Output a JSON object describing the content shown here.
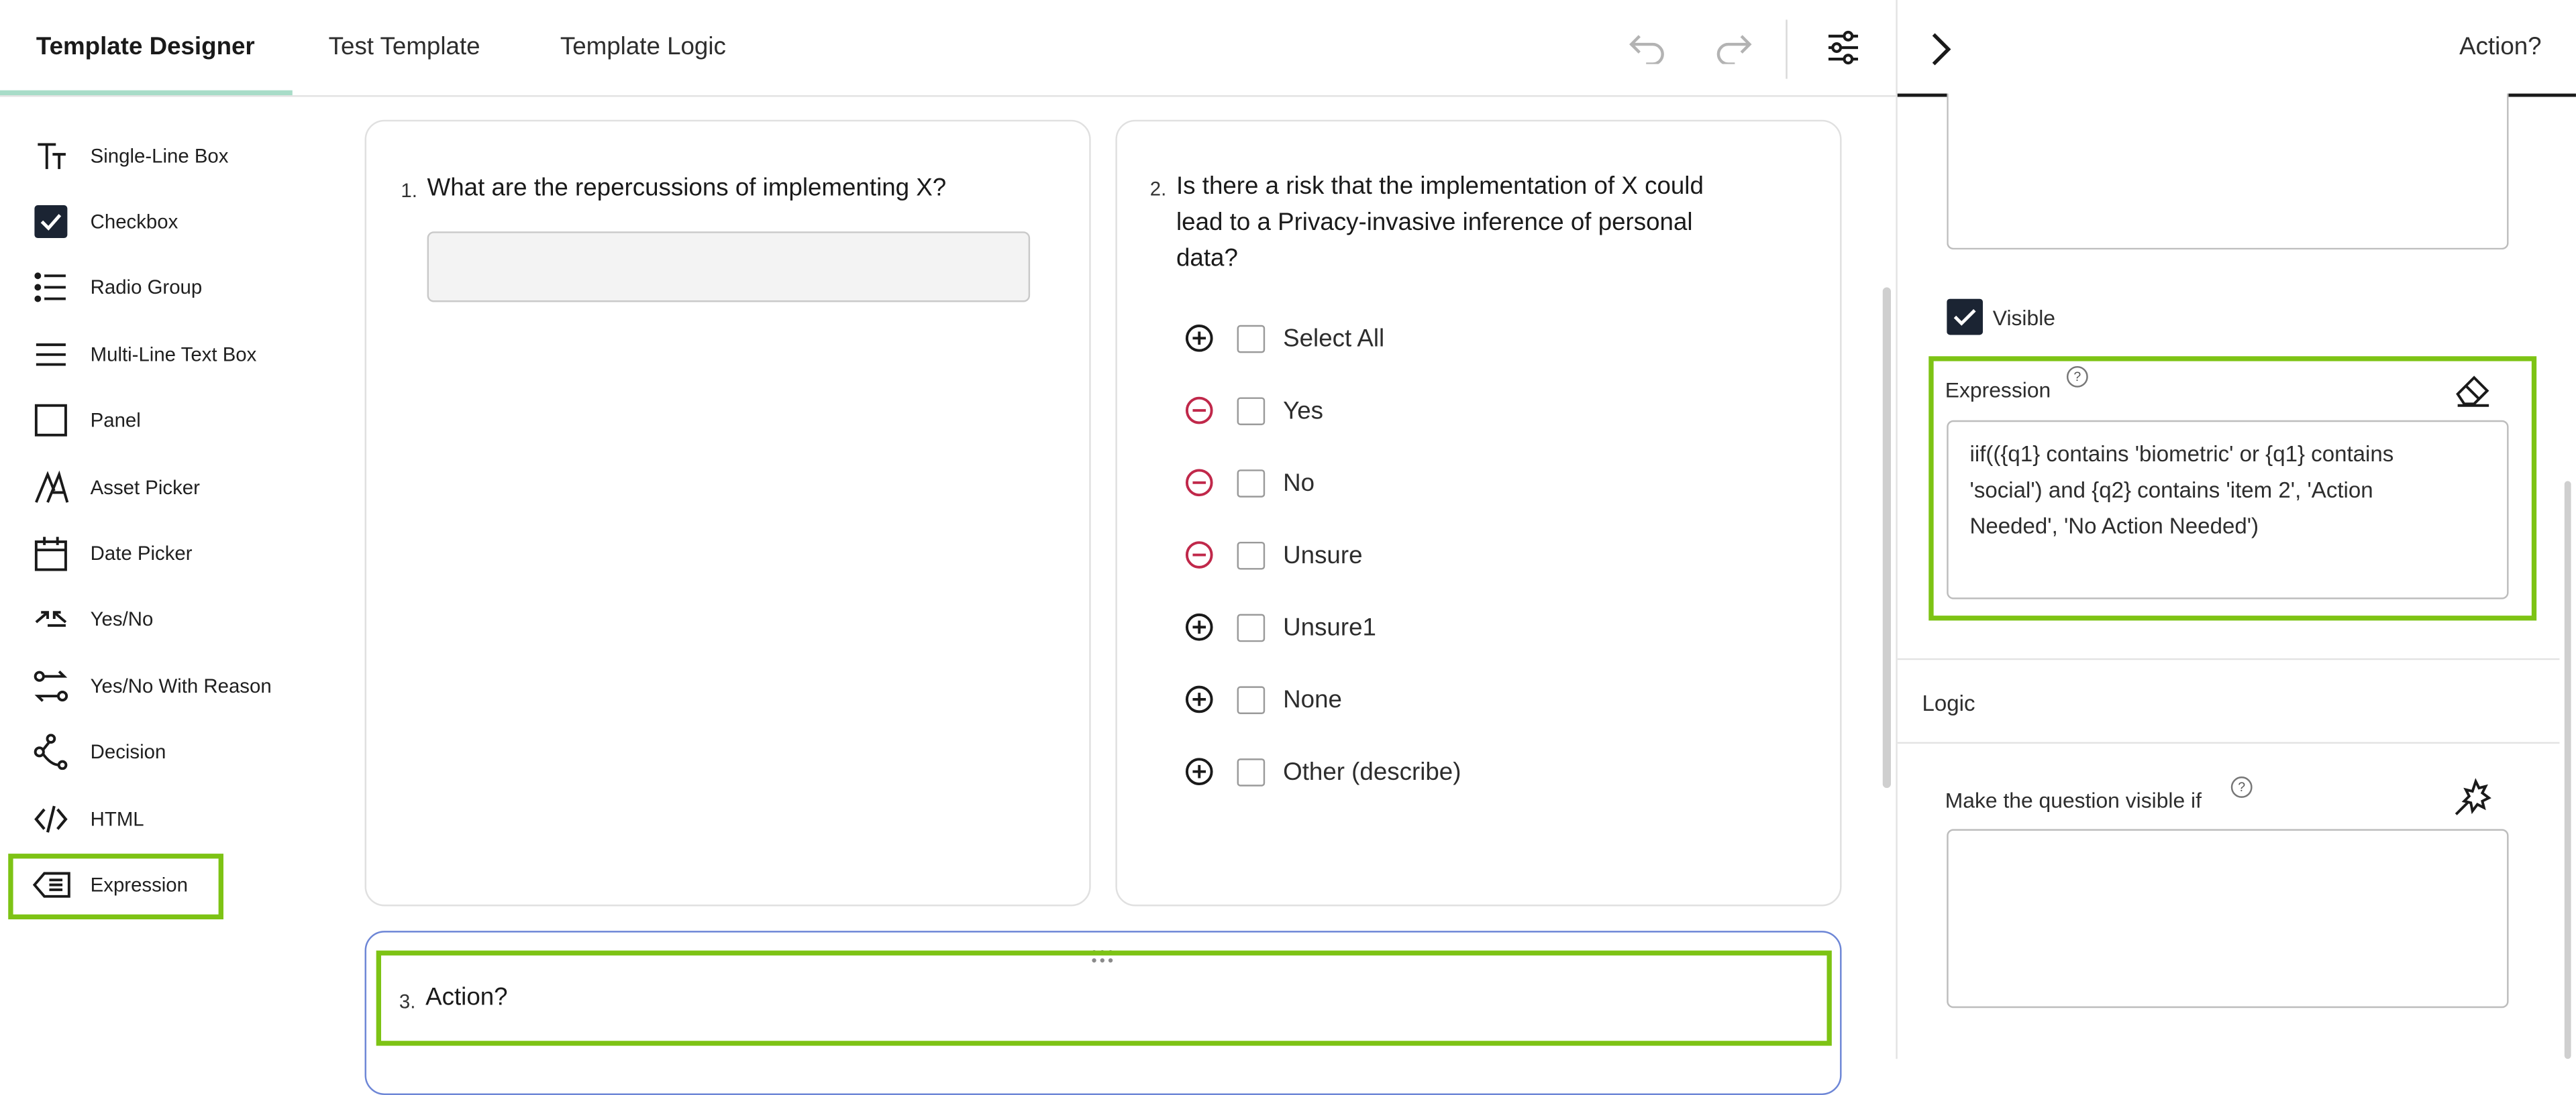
{
  "tabs": [
    {
      "label": "Template Designer",
      "active": true
    },
    {
      "label": "Test Template",
      "active": false
    },
    {
      "label": "Template Logic",
      "active": false
    }
  ],
  "toolbar_icons": [
    "undo-icon",
    "redo-icon",
    "settings-sliders-icon"
  ],
  "toolbox": {
    "items": [
      {
        "label": "Single-Line Box",
        "icon": "text-type-icon"
      },
      {
        "label": "Checkbox",
        "icon": "checkbox-icon"
      },
      {
        "label": "Radio Group",
        "icon": "list-icon"
      },
      {
        "label": "Multi-Line Text Box",
        "icon": "lines-icon"
      },
      {
        "label": "Panel",
        "icon": "square-icon"
      },
      {
        "label": "Asset Picker",
        "icon": "asset-icon"
      },
      {
        "label": "Date Picker",
        "icon": "calendar-icon"
      },
      {
        "label": "Yes/No",
        "icon": "arrows-in-icon"
      },
      {
        "label": "Yes/No With Reason",
        "icon": "arrows-swap-icon"
      },
      {
        "label": "Decision",
        "icon": "branch-icon"
      },
      {
        "label": "HTML",
        "icon": "code-icon"
      },
      {
        "label": "Expression",
        "icon": "expression-tag-icon"
      }
    ]
  },
  "questions": {
    "q1": {
      "number": "1.",
      "title": "What are the repercussions of implementing X?"
    },
    "q2": {
      "number": "2.",
      "title_lines": [
        "Is there a risk that the implementation of X could",
        "lead to a Privacy-invasive inference of personal",
        "data?"
      ],
      "choices": [
        {
          "label": "Select All",
          "action": "add"
        },
        {
          "label": "Yes",
          "action": "remove"
        },
        {
          "label": "No",
          "action": "remove"
        },
        {
          "label": "Unsure",
          "action": "remove"
        },
        {
          "label": "Unsure1",
          "action": "add"
        },
        {
          "label": "None",
          "action": "add"
        },
        {
          "label": "Other (describe)",
          "action": "add"
        }
      ]
    },
    "q3": {
      "number": "3.",
      "title": "Action?"
    }
  },
  "panel": {
    "title": "Action?",
    "visible_label": "Visible",
    "visible_checked": true,
    "expression_label": "Expression",
    "expression_lines": [
      "iif(({q1} contains 'biometric' or {q1} contains",
      "'social') and {q2} contains 'item 2', 'Action",
      "Needed', 'No Action Needed')"
    ],
    "help_glyph": "?",
    "logic_label": "Logic",
    "visible_if_label": "Make the question visible if"
  },
  "colors": {
    "highlight": "#7dc314",
    "remove_icon": "#c0284a",
    "checkbox_fill": "#1b2433",
    "tab_underline": "#a8dcc8"
  }
}
